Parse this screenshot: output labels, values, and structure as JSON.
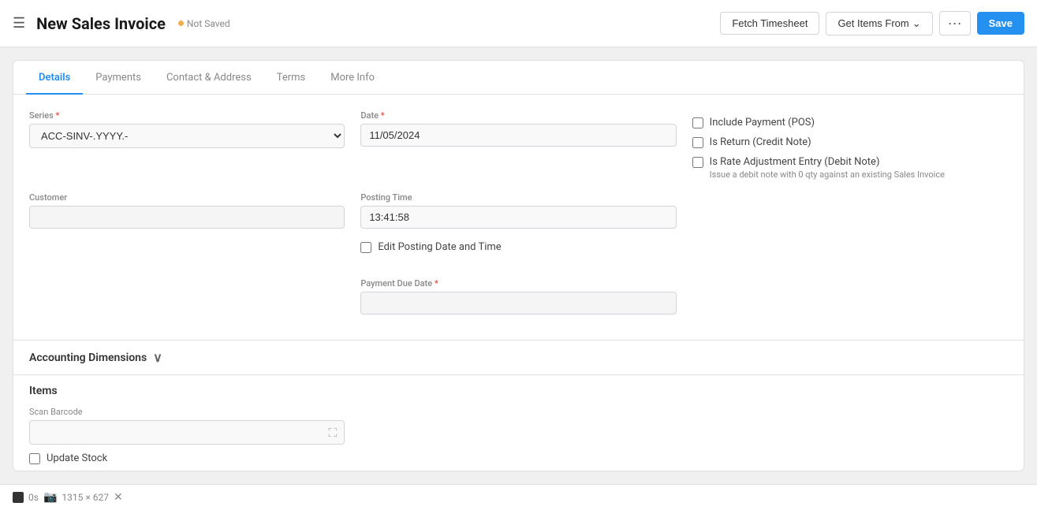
{
  "topbar": {
    "hamburger": "☰",
    "title": "New Sales Invoice",
    "not_saved": "Not Saved",
    "fetch_timesheet": "Fetch Timesheet",
    "get_items_from": "Get Items From",
    "more_options": "···",
    "save": "Save"
  },
  "tabs": [
    {
      "id": "details",
      "label": "Details",
      "active": true
    },
    {
      "id": "payments",
      "label": "Payments",
      "active": false
    },
    {
      "id": "contact-address",
      "label": "Contact & Address",
      "active": false
    },
    {
      "id": "terms",
      "label": "Terms",
      "active": false
    },
    {
      "id": "more-info",
      "label": "More Info",
      "active": false
    }
  ],
  "fields": {
    "series_label": "Series",
    "series_value": "ACC-SINV-.YYYY.-",
    "date_label": "Date",
    "date_value": "11/05/2024",
    "customer_label": "Customer",
    "customer_value": "",
    "customer_placeholder": "",
    "posting_time_label": "Posting Time",
    "posting_time_value": "13:41:58",
    "edit_posting_label": "Edit Posting Date and Time",
    "payment_due_date_label": "Payment Due Date",
    "payment_due_date_value": ""
  },
  "checkboxes": {
    "include_payment": "Include Payment (POS)",
    "is_return": "Is Return (Credit Note)",
    "rate_adjustment": "Is Rate Adjustment Entry (Debit Note)",
    "rate_adjustment_desc": "Issue a debit note with 0 qty against an existing Sales Invoice"
  },
  "accounting_dimensions": {
    "label": "Accounting Dimensions"
  },
  "items_section": {
    "label": "Items",
    "scan_barcode_label": "Scan Barcode",
    "update_stock_label": "Update Stock"
  },
  "bottom_bar": {
    "timer": "0s",
    "dimensions": "1315 × 627"
  }
}
